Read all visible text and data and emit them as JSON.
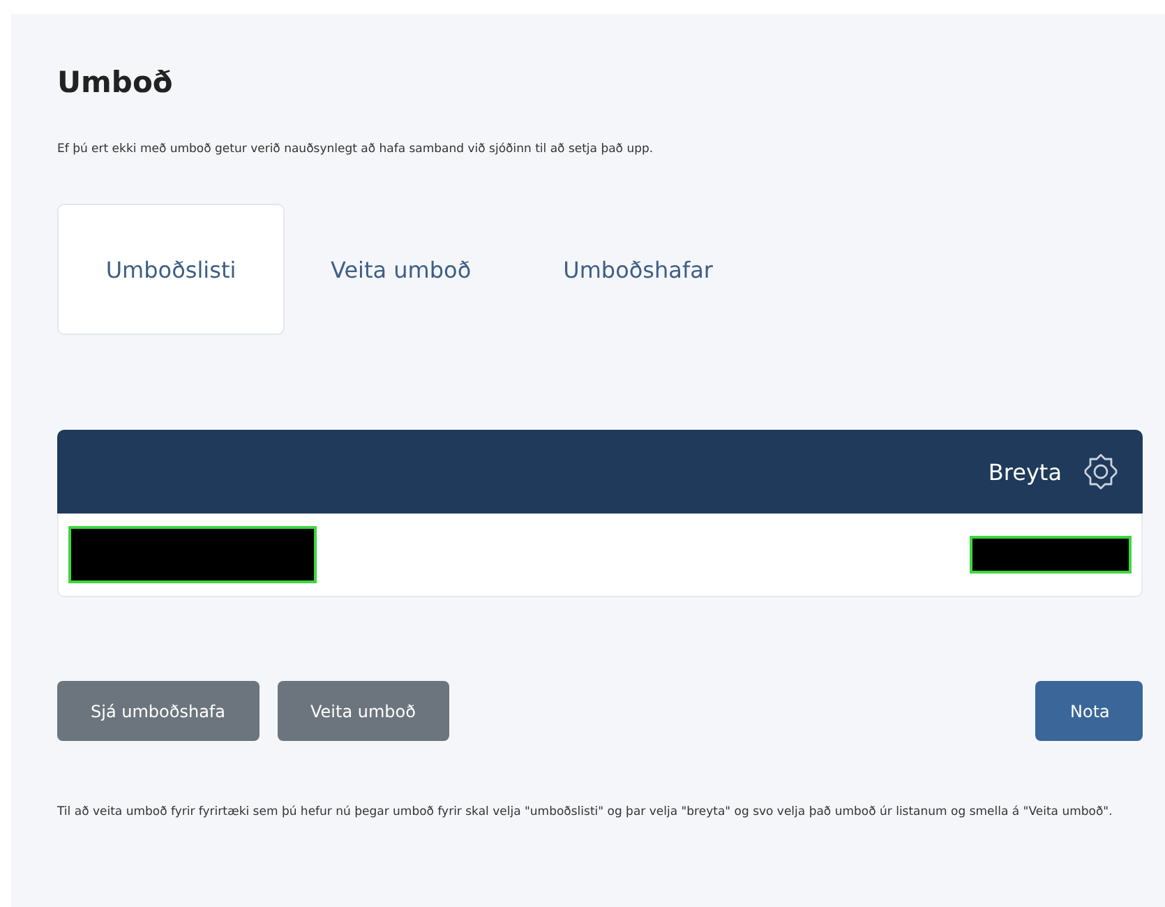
{
  "title": "Umboð",
  "intro": "Ef þú ert ekki með umboð getur verið nauðsynlegt að hafa samband við sjóðinn til að setja það upp.",
  "tabs": [
    {
      "label": "Umboðslisti",
      "selected": true
    },
    {
      "label": "Veita umboð",
      "selected": false
    },
    {
      "label": "Umboðshafar",
      "selected": false
    }
  ],
  "table": {
    "header_action": "Breyta",
    "row_cells": [
      {
        "kind": "redacted"
      },
      {
        "kind": "redacted"
      }
    ]
  },
  "buttons": [
    {
      "label": "Sjá umboðshafa",
      "kind": "secondary"
    },
    {
      "label": "Veita umboð",
      "kind": "secondary"
    },
    {
      "label": "Nota",
      "kind": "primary"
    }
  ],
  "footnote": "Til að veita umboð fyrir fyrirtæki sem þú hefur nú þegar umboð fyrir skal velja \"umboðslisti\" og þar velja \"breyta\" og svo velja það umboð úr listanum og smella á \"Veita umboð\"."
}
